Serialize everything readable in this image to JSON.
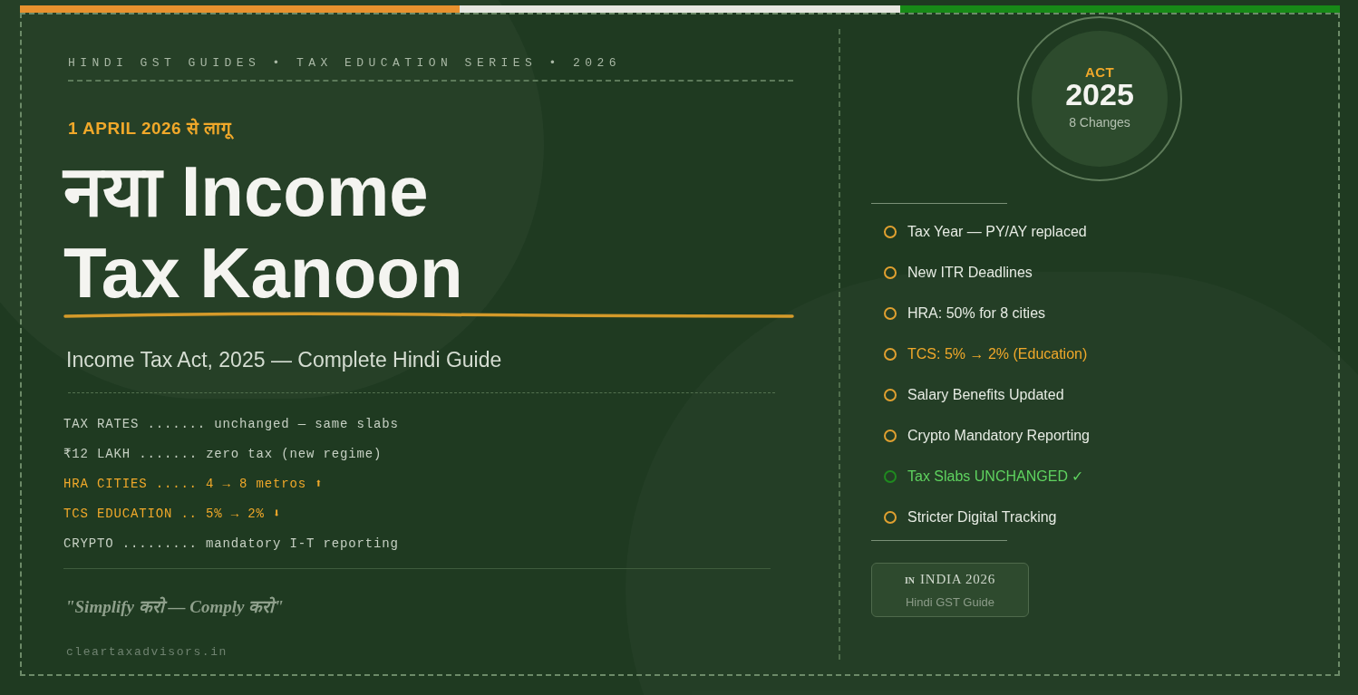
{
  "header": {
    "series": "HINDI GST GUIDES • TAX EDUCATION SERIES • 2026",
    "effective": "1 APRIL 2026 से लागू"
  },
  "title": {
    "line_1": "नया Income",
    "line_2": "Tax Kanoon"
  },
  "subtitle": "Income Tax Act, 2025 — Complete Hindi Guide",
  "facts": [
    {
      "text": "TAX RATES ....... unchanged — same slabs",
      "kind": "normal"
    },
    {
      "text": "₹12 LAKH ....... zero tax (new regime)",
      "kind": "normal"
    },
    {
      "text": "HRA CITIES ..... 4 → 8 metros ⬆",
      "kind": "highlight"
    },
    {
      "text": "TCS EDUCATION .. 5% → 2% ⬇",
      "kind": "highlight"
    },
    {
      "text": "CRYPTO ......... mandatory I-T reporting",
      "kind": "normal"
    }
  ],
  "quote": "\"Simplify करो — Comply करो\"",
  "website": "cleartaxadvisors.in",
  "badge": {
    "label": "ACT",
    "year": "2025",
    "caption": "8 Changes"
  },
  "changes": [
    {
      "text": "Tax Year — PY/AY replaced",
      "kind": "normal"
    },
    {
      "text": "New ITR Deadlines",
      "kind": "normal"
    },
    {
      "text": "HRA: 50% for 8 cities",
      "kind": "normal"
    },
    {
      "text": "TCS: 5% → 2% (Education)",
      "kind": "highlight"
    },
    {
      "text": "Salary Benefits Updated",
      "kind": "normal"
    },
    {
      "text": "Crypto Mandatory Reporting",
      "kind": "normal"
    },
    {
      "text": "Tax Slabs UNCHANGED ✓",
      "kind": "positive"
    },
    {
      "text": "Stricter Digital Tracking",
      "kind": "normal"
    }
  ],
  "stamp": {
    "code": "IN",
    "title": "INDIA 2026",
    "caption": "Hindi GST Guide"
  }
}
